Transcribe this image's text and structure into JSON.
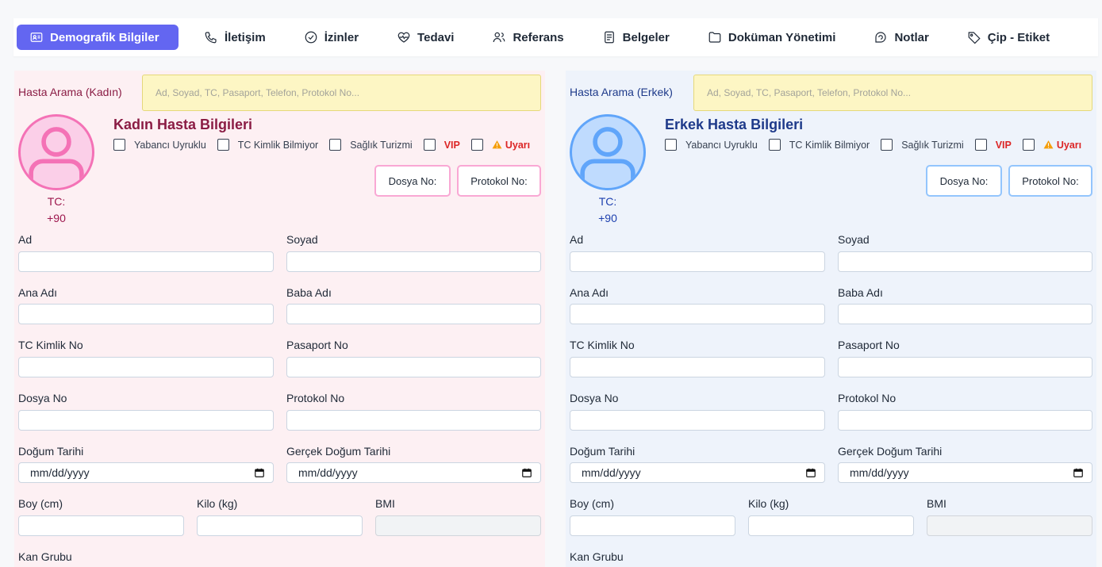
{
  "tabs": [
    {
      "label": "Demografik Bilgiler",
      "icon": "id-card-icon",
      "active": true
    },
    {
      "label": "İletişim",
      "icon": "phone-icon"
    },
    {
      "label": "İzinler",
      "icon": "check-circle-icon"
    },
    {
      "label": "Tedavi",
      "icon": "heart-pulse-icon"
    },
    {
      "label": "Referans",
      "icon": "users-icon"
    },
    {
      "label": "Belgeler",
      "icon": "document-icon"
    },
    {
      "label": "Doküman Yönetimi",
      "icon": "folder-icon"
    },
    {
      "label": "Notlar",
      "icon": "sticky-note-icon"
    },
    {
      "label": "Çip - Etiket",
      "icon": "tag-icon"
    }
  ],
  "female": {
    "search_label": "Hasta Arama (Kadın)",
    "search_placeholder": "Ad, Soyad, TC, Pasaport, Telefon, Protokol No...",
    "title": "Kadın Hasta Bilgileri",
    "tc_label": "TC:",
    "phone_prefix": "+90",
    "checkboxes": {
      "foreign": "Yabancı Uyruklu",
      "no_tc": "TC Kimlik Bilmiyor",
      "health_tourism": "Sağlık Turizmi",
      "vip": "VIP",
      "warning": "Uyarı"
    },
    "file_no": "Dosya No:",
    "protocol_no": "Protokol No:",
    "fields": {
      "name": "Ad",
      "surname": "Soyad",
      "mother": "Ana Adı",
      "father": "Baba Adı",
      "tc": "TC Kimlik No",
      "passport": "Pasaport No",
      "file": "Dosya No",
      "protocol": "Protokol No",
      "birth": "Doğum Tarihi",
      "real_birth": "Gerçek Doğum Tarihi",
      "height": "Boy (cm)",
      "weight": "Kilo (kg)",
      "bmi": "BMI",
      "blood": "Kan Grubu"
    },
    "date_placeholder": "mm/dd/yyyy"
  },
  "male": {
    "search_label": "Hasta Arama (Erkek)",
    "search_placeholder": "Ad, Soyad, TC, Pasaport, Telefon, Protokol No...",
    "title": "Erkek Hasta Bilgileri",
    "tc_label": "TC:",
    "phone_prefix": "+90",
    "checkboxes": {
      "foreign": "Yabancı Uyruklu",
      "no_tc": "TC Kimlik Bilmiyor",
      "health_tourism": "Sağlık Turizmi",
      "vip": "VIP",
      "warning": "Uyarı"
    },
    "file_no": "Dosya No:",
    "protocol_no": "Protokol No:",
    "fields": {
      "name": "Ad",
      "surname": "Soyad",
      "mother": "Ana Adı",
      "father": "Baba Adı",
      "tc": "TC Kimlik No",
      "passport": "Pasaport No",
      "file": "Dosya No",
      "protocol": "Protokol No",
      "birth": "Doğum Tarihi",
      "real_birth": "Gerçek Doğum Tarihi",
      "height": "Boy (cm)",
      "weight": "Kilo (kg)",
      "bmi": "BMI",
      "blood": "Kan Grubu"
    },
    "date_placeholder": "mm/dd/yyyy"
  },
  "colors": {
    "accent": "#6366f1",
    "female_bg": "#fdf0f3",
    "male_bg": "#eef3fb",
    "search_bg": "#fdf6c4",
    "warning": "#dc2626"
  }
}
